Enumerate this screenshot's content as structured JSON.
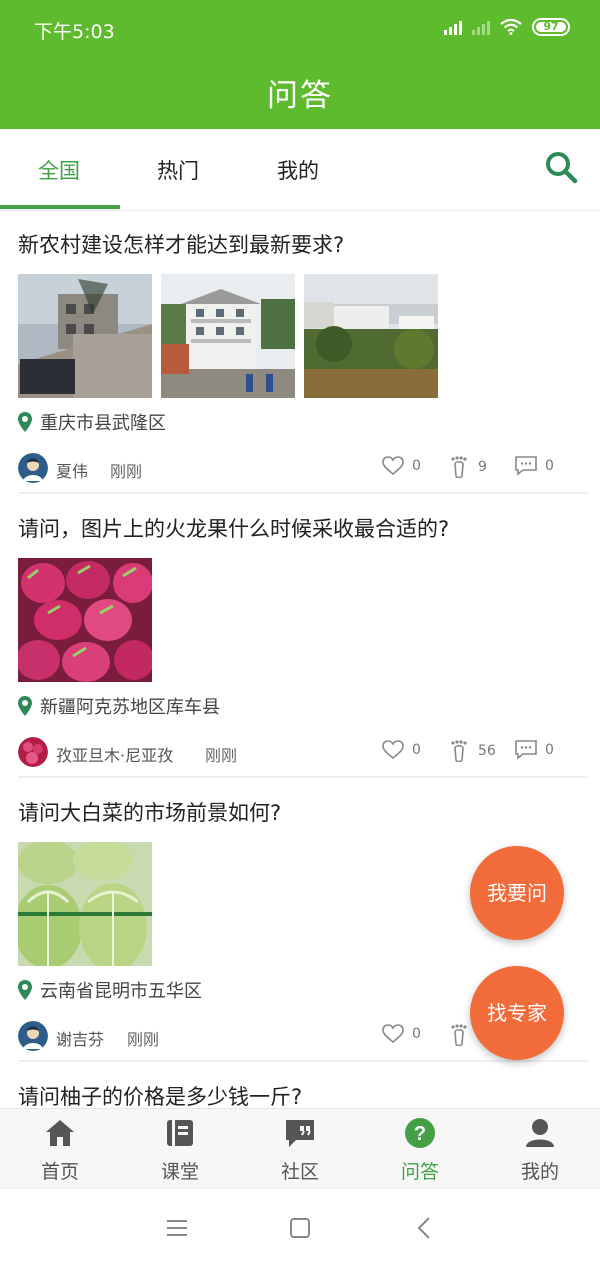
{
  "status_bar": {
    "time": "下午5:03",
    "battery": "97"
  },
  "header": {
    "title": "问答"
  },
  "tabs": [
    {
      "label": "全国",
      "active": true
    },
    {
      "label": "热门",
      "active": false
    },
    {
      "label": "我的",
      "active": false
    }
  ],
  "questions": [
    {
      "title": "新农村建设怎样才能达到最新要求?",
      "location": "重庆市县武隆区",
      "author": "夏伟",
      "time": "刚刚",
      "likes": "0",
      "footprints": "9",
      "comments": "0",
      "photo_count": 3
    },
    {
      "title": "请问，图片上的火龙果什么时候采收最合适的?",
      "location": "新疆阿克苏地区库车县",
      "author": "孜亚旦木·尼亚孜",
      "time": "刚刚",
      "likes": "0",
      "footprints": "56",
      "comments": "0",
      "photo_count": 1
    },
    {
      "title": "请问大白菜的市场前景如何?",
      "location": "云南省昆明市五华区",
      "author": "谢吉芬",
      "time": "刚刚",
      "likes": "0",
      "photo_count": 1
    },
    {
      "title": "请问柚子的价格是多少钱一斤?"
    }
  ],
  "fabs": {
    "ask": "我要问",
    "expert": "找专家"
  },
  "bottom_nav": [
    {
      "label": "首页",
      "icon": "home-icon",
      "active": false
    },
    {
      "label": "课堂",
      "icon": "book-icon",
      "active": false
    },
    {
      "label": "社区",
      "icon": "quote-chat-icon",
      "active": false
    },
    {
      "label": "问答",
      "icon": "question-circle-icon",
      "active": true
    },
    {
      "label": "我的",
      "icon": "user-icon",
      "active": false
    }
  ],
  "colors": {
    "primary": "#5fbb2e",
    "accent_green": "#43a047",
    "fab_orange": "#f26b3a"
  }
}
